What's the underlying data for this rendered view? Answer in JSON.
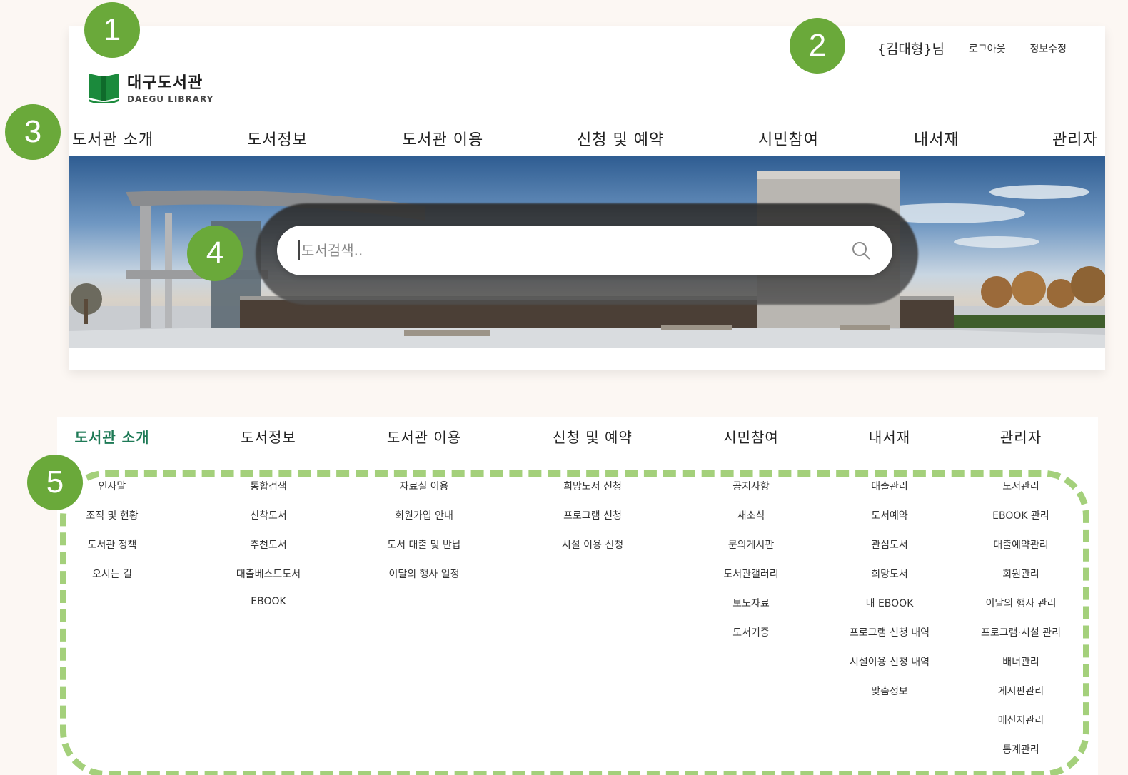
{
  "markers": [
    "1",
    "2",
    "3",
    "4",
    "5"
  ],
  "logo": {
    "title": "대구도서관",
    "subtitle": "DAEGU LIBRARY",
    "icon": "book-icon"
  },
  "user": {
    "name": "{김대형}님",
    "logout": "로그아웃",
    "edit": "정보수정"
  },
  "nav": [
    "도서관 소개",
    "도서정보",
    "도서관 이용",
    "신청 및 예약",
    "시민참여",
    "내서재",
    "관리자"
  ],
  "search": {
    "placeholder": "도서검색..",
    "icon": "search-icon"
  },
  "mega_menu": {
    "active": "도서관 소개",
    "columns": [
      {
        "title": "도서관 소개",
        "items": [
          "인사말",
          "조직 및 현황",
          "도서관 정책",
          "오시는 길"
        ]
      },
      {
        "title": "도서정보",
        "items": [
          "통합검색",
          "신착도서",
          "추천도서",
          "대출베스트도서",
          "EBOOK"
        ]
      },
      {
        "title": "도서관 이용",
        "items": [
          "자료실 이용",
          "회원가입 안내",
          "도서 대출 및 반납",
          "이달의 행사 일정"
        ]
      },
      {
        "title": "신청 및 예약",
        "items": [
          "희망도서 신청",
          "프로그램 신청",
          "시설 이용 신청"
        ]
      },
      {
        "title": "시민참여",
        "items": [
          "공지사항",
          "새소식",
          "문의게시판",
          "도서관갤러리",
          "보도자료",
          "도서기증"
        ]
      },
      {
        "title": "내서재",
        "items": [
          "대출관리",
          "도서예약",
          "관심도서",
          "희망도서",
          "내 EBOOK",
          "프로그램 신청 내역",
          "시설이용 신청 내역",
          "맞춤정보"
        ]
      },
      {
        "title": "관리자",
        "items": [
          "도서관리",
          "EBOOK 관리",
          "대출예약관리",
          "회원관리",
          "이달의 행사 관리",
          "프로그램·시설 관리",
          "배너관리",
          "게시판관리",
          "메신저관리",
          "통계관리"
        ]
      }
    ]
  },
  "colors": {
    "accent_green": "#6aa93a",
    "active_menu": "#1e7a56",
    "dash_border": "#a4d07b"
  }
}
